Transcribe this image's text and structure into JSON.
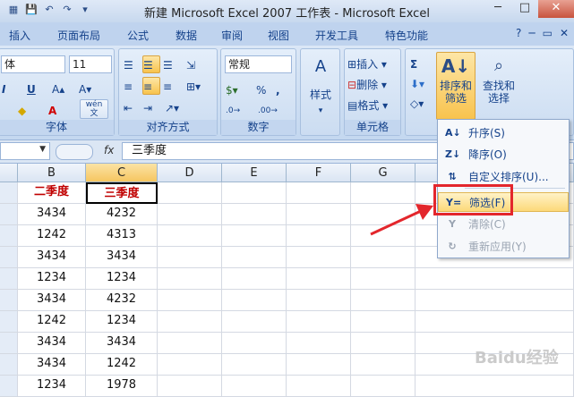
{
  "window": {
    "title": "新建 Microsoft Excel 2007 工作表 - Microsoft Excel",
    "minimize": "─",
    "maximize": "□",
    "close": "✕"
  },
  "ribbon_tabs": [
    "插入",
    "页面布局",
    "公式",
    "数据",
    "审阅",
    "视图",
    "开发工具",
    "特色功能"
  ],
  "font_group": {
    "font_name": "体",
    "font_size": "11",
    "underline": "U",
    "label": "字体",
    "wen": "wén 文"
  },
  "align_group": {
    "label": "对齐方式"
  },
  "number_group": {
    "format": "常规",
    "percent": "%",
    "comma": ",",
    "label": "数字"
  },
  "styles_group": {
    "label": "样式"
  },
  "cells_group": {
    "insert": "插入",
    "delete": "删除",
    "format": "格式",
    "label": "单元格"
  },
  "edit_group": {
    "sum": "Σ",
    "sort_filter": "排序和\n筛选",
    "sort_line1": "排序和",
    "sort_line2": "筛选",
    "find_line1": "查找和",
    "find_line2": "选择"
  },
  "formula_bar": {
    "fx": "fx",
    "content": "三季度"
  },
  "columns": [
    "B",
    "C",
    "D",
    "E",
    "F",
    "G"
  ],
  "rows": [
    [
      "二季度",
      "三季度"
    ],
    [
      "3434",
      "4232"
    ],
    [
      "1242",
      "4313"
    ],
    [
      "3434",
      "3434"
    ],
    [
      "1234",
      "1234"
    ],
    [
      "3434",
      "4232"
    ],
    [
      "1242",
      "1234"
    ],
    [
      "3434",
      "3434"
    ],
    [
      "3434",
      "1242"
    ],
    [
      "1234",
      "1978"
    ]
  ],
  "menu": {
    "sort_asc": "升序(S)",
    "sort_desc": "降序(O)",
    "custom_sort": "自定义排序(U)...",
    "filter": "筛选(F)",
    "clear": "清除(C)",
    "reapply": "重新应用(Y)"
  },
  "watermark": "Baidu经验",
  "colors": {
    "accent_red": "#c00000",
    "highlight_box": "#e3262c",
    "ribbon": "#c4d8f0"
  }
}
